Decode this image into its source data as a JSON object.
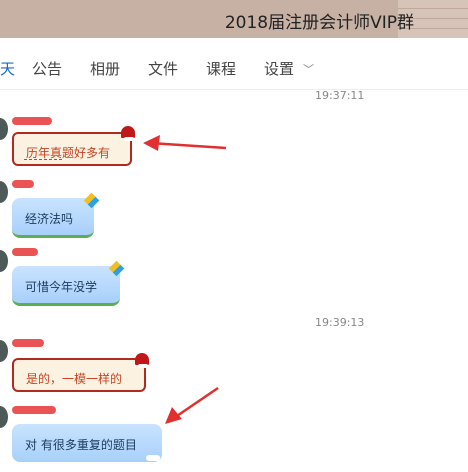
{
  "window": {
    "title": "2018届注册会计师VIP群"
  },
  "tabs": [
    {
      "label": "天"
    },
    {
      "label": "公告"
    },
    {
      "label": "相册"
    },
    {
      "label": "文件"
    },
    {
      "label": "课程"
    },
    {
      "label": "设置"
    }
  ],
  "chat": {
    "timestamps": [
      "19:37:11",
      "19:39:13"
    ],
    "messages": [
      {
        "text": "历年真题好多有"
      },
      {
        "text": "经济法吗"
      },
      {
        "text": "可惜今年没学"
      },
      {
        "text": "是的，一模一样的"
      },
      {
        "text": "对 有很多重复的题目"
      }
    ]
  },
  "colors": {
    "arrow": "#e03030",
    "red_bubble_border": "#b02a20",
    "blue_bubble": "#a8d0fa"
  }
}
